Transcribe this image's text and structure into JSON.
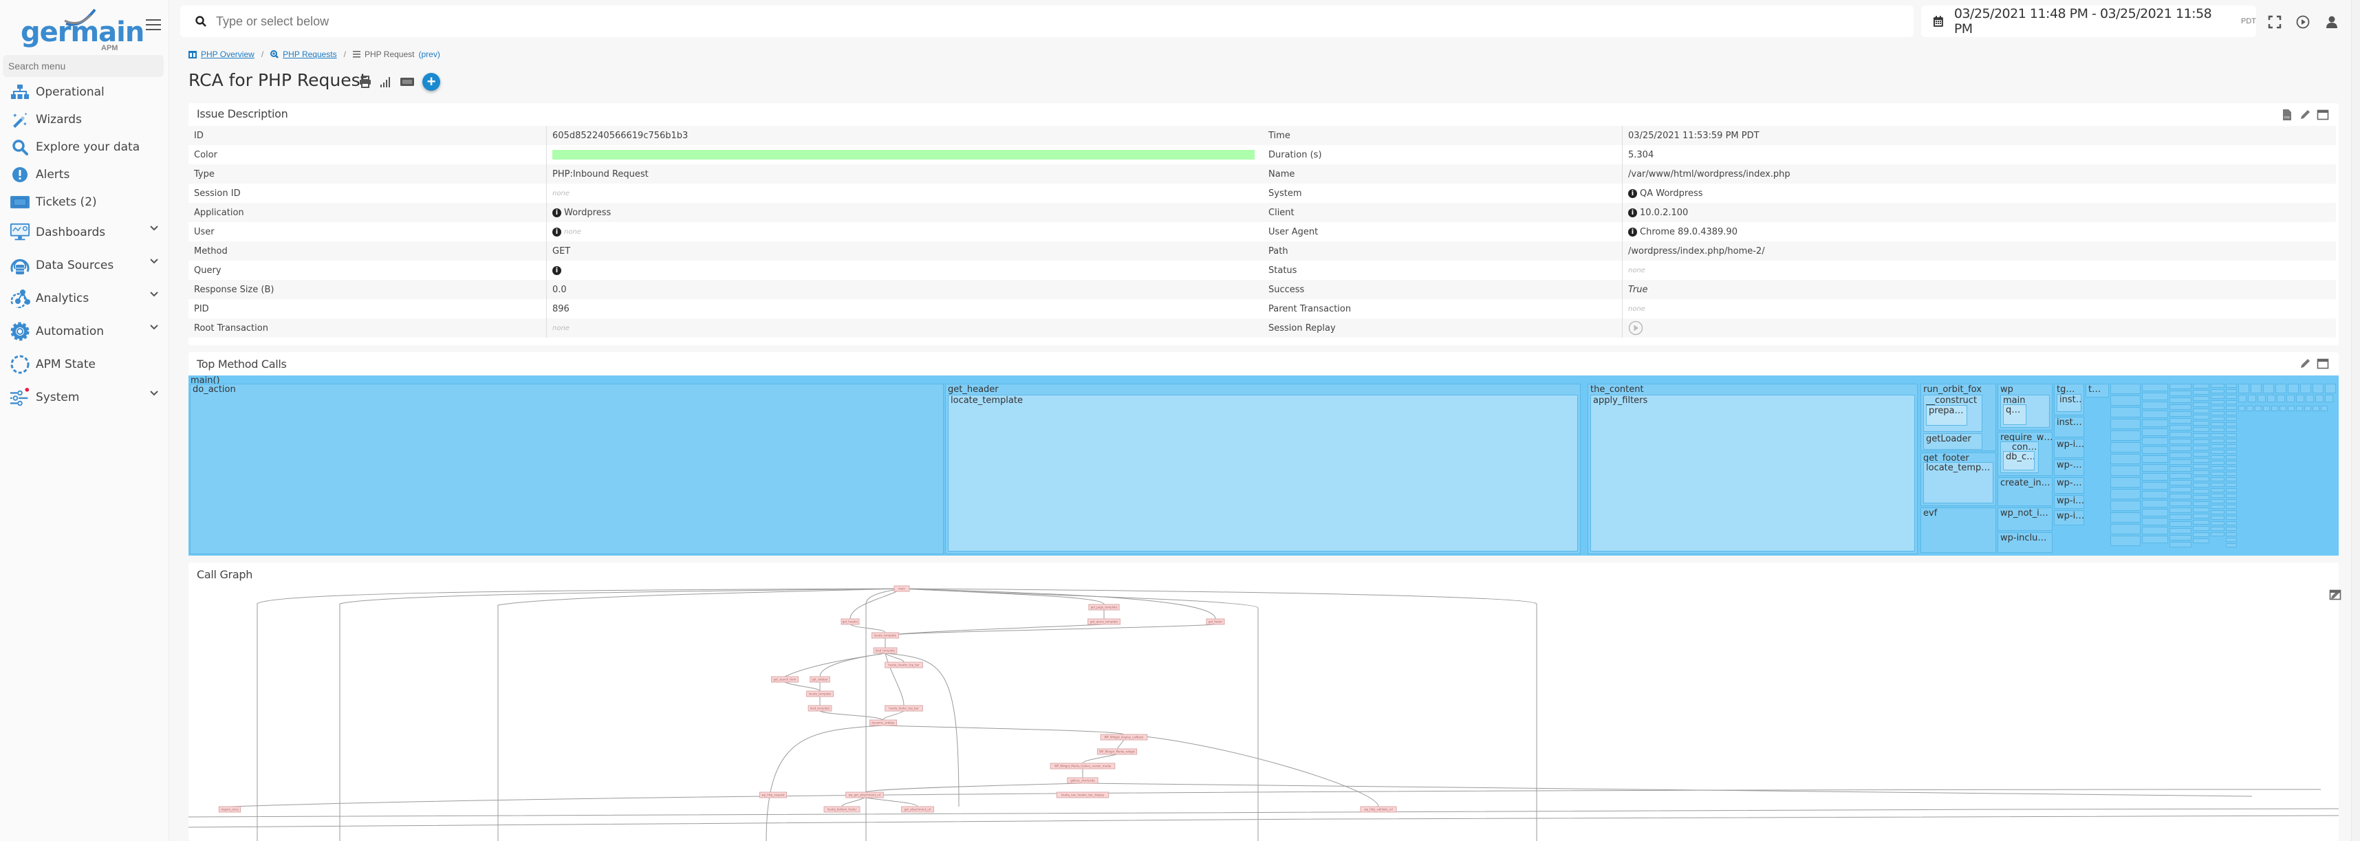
{
  "app": {
    "logo_text": "germain",
    "logo_sub": "APM"
  },
  "sidebar": {
    "search_placeholder": "Search menu",
    "items": [
      {
        "label": "Operational",
        "icon": "sitemap-icon",
        "expandable": false
      },
      {
        "label": "Wizards",
        "icon": "magic-wand-icon",
        "expandable": false
      },
      {
        "label": "Explore your data",
        "icon": "search-icon",
        "expandable": false
      },
      {
        "label": "Alerts",
        "icon": "alert-circle-icon",
        "expandable": false
      },
      {
        "label": "Tickets (2)",
        "icon": "ticket-icon",
        "expandable": false
      },
      {
        "label": "Dashboards",
        "icon": "dashboard-monitor-icon",
        "expandable": true
      },
      {
        "label": "Data Sources",
        "icon": "database-icon",
        "expandable": true
      },
      {
        "label": "Analytics",
        "icon": "analytics-icon",
        "expandable": true
      },
      {
        "label": "Automation",
        "icon": "gear-icon",
        "expandable": true
      },
      {
        "label": "APM State",
        "icon": "dotted-circle-icon",
        "expandable": false
      },
      {
        "label": "System",
        "icon": "sliders-icon",
        "expandable": true,
        "badge_color": "#e8194b"
      }
    ]
  },
  "topbar": {
    "search_placeholder": "Type or select below",
    "date_range": "03/25/2021 11:48 PM - 03/25/2021 11:58 PM",
    "timezone": "PDT"
  },
  "breadcrumb": {
    "items": [
      {
        "label": "PHP Overview",
        "icon": "columns-icon",
        "link": true
      },
      {
        "label": "PHP Requests",
        "icon": "search-plus-icon",
        "link": true
      },
      {
        "label": "PHP Request",
        "icon": "list-icon",
        "link": false
      }
    ],
    "prev_label": "(prev)"
  },
  "page": {
    "title": "RCA for PHP Request"
  },
  "issue_description": {
    "title": "Issue Description",
    "left": [
      {
        "key": "ID",
        "value": "605d852240566619c756b1b3"
      },
      {
        "key": "Color",
        "value": "",
        "color": "#adffab"
      },
      {
        "key": "Type",
        "value": "PHP:Inbound Request"
      },
      {
        "key": "Session ID",
        "value": "none",
        "none": true
      },
      {
        "key": "Application",
        "value": "Wordpress",
        "info": true
      },
      {
        "key": "User",
        "value": "none",
        "none": true,
        "info": true
      },
      {
        "key": "Method",
        "value": "GET"
      },
      {
        "key": "Query",
        "value": "",
        "info": true
      },
      {
        "key": "Response Size (B)",
        "value": "0.0"
      },
      {
        "key": "PID",
        "value": "896"
      },
      {
        "key": "Root Transaction",
        "value": "none",
        "none": true
      }
    ],
    "right": [
      {
        "key": "Time",
        "value": "03/25/2021 11:53:59 PM PDT"
      },
      {
        "key": "Duration (s)",
        "value": "5.304"
      },
      {
        "key": "Name",
        "value": "/var/www/html/wordpress/index.php"
      },
      {
        "key": "System",
        "value": "QA Wordpress",
        "info": true
      },
      {
        "key": "Client",
        "value": "10.0.2.100",
        "info": true
      },
      {
        "key": "User Agent",
        "value": "Chrome 89.0.4389.90",
        "info": true
      },
      {
        "key": "Path",
        "value": "/wordpress/index.php/home-2/"
      },
      {
        "key": "Status",
        "value": "none",
        "none": true
      },
      {
        "key": "Success",
        "value": "True",
        "italic": true
      },
      {
        "key": "Parent Transaction",
        "value": "none",
        "none": true
      },
      {
        "key": "Session Replay",
        "value": "",
        "replay": true
      }
    ]
  },
  "top_method_calls": {
    "title": "Top Method Calls",
    "root": "main()",
    "nodes": [
      {
        "label": "do_action",
        "children": []
      },
      {
        "label": "get_header",
        "children": [
          "locate_template"
        ]
      },
      {
        "label": "the_content",
        "children": [
          "apply_filters"
        ]
      },
      {
        "label": "run_orbit_fox",
        "children": [
          "__construct",
          "prepa…",
          "getLoader"
        ]
      },
      {
        "label": "get_footer",
        "children": [
          "locate_temp…"
        ]
      },
      {
        "label": "evf",
        "children": []
      },
      {
        "label": "wp",
        "children": [
          "main",
          "q…"
        ]
      },
      {
        "label": "require_w…",
        "children": [
          "__con…",
          "db_c…"
        ]
      },
      {
        "label": "create_in…",
        "children": []
      },
      {
        "label": "wp_not_i…",
        "children": []
      },
      {
        "label": "wp-inclu…",
        "children": []
      },
      {
        "label": "tg…",
        "children": [
          "inst…"
        ]
      },
      {
        "label": "inst…",
        "children": []
      },
      {
        "label": "wp-i…",
        "children": []
      },
      {
        "label": "wp-…",
        "children": []
      },
      {
        "label": "wp-…",
        "children": []
      },
      {
        "label": "wp-i…",
        "children": []
      },
      {
        "label": "wp-i…",
        "children": []
      },
      {
        "label": "t…",
        "children": []
      }
    ]
  },
  "call_graph": {
    "title": "Call Graph",
    "nodes": [
      "main",
      "get_header",
      "get_page_template",
      "get_query_template",
      "get_footer",
      "locate_template",
      "load_template",
      "hestia_header_top_bar",
      "get_search_form",
      "get_sidebar",
      "locate_template",
      "load_template",
      "hestia_footer_top_bar",
      "dynamic_sidebar",
      "WP_Widget_display_callback",
      "WP_Widget_Media_widget",
      "WP_Widget_Media_Gallery_render_media",
      "gallery_shortcode",
      "wp_get_attachment_url",
      "hestia_nav_header_bar_display",
      "hestia_bottom_footer",
      "get_attachment_url",
      "wp_http_request",
      "wp_http_validate_url",
      "require_once"
    ]
  },
  "panel_icons": {
    "export": "csv-file-icon",
    "edit": "pencil-icon",
    "maximize": "window-maximize-icon"
  }
}
